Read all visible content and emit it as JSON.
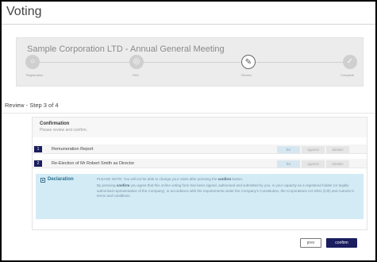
{
  "page": {
    "title": "Voting"
  },
  "meeting": {
    "title": "Sample Corporation LTD - Annual General Meeting"
  },
  "steps": [
    {
      "label": "Registration",
      "icon": "○",
      "state": "done"
    },
    {
      "label": "PAS",
      "icon": "◎",
      "state": "done"
    },
    {
      "label": "Review",
      "icon": "✎",
      "state": "current"
    },
    {
      "label": "Complete",
      "icon": "✓",
      "state": "pending"
    }
  ],
  "review_heading": "Review - Step 3 of 4",
  "confirmation": {
    "title": "Confirmation",
    "subtitle": "Please review and confirm."
  },
  "resolutions": [
    {
      "number": "1",
      "text": "Remuneration Report",
      "options": [
        "for",
        "against",
        "abstain"
      ],
      "selected": "for"
    },
    {
      "number": "2",
      "text": "Re-Election of Mr Robert Smith as Director",
      "options": [
        "for",
        "against",
        "abstain"
      ],
      "selected": "for"
    }
  ],
  "declaration": {
    "label": "Declaration",
    "note_prefix": "PLEASE NOTE: You will not be able to change your votes after pressing the ",
    "note_bold": "confirm",
    "note_suffix": " button.",
    "body_prefix": "By pressing ",
    "body_bold": "confirm",
    "body_suffix": " you agree that this online voting form has been signed, authorised and submitted by you, in your capacity as a registered holder (or legally authorised representative of the Company), in accordance with the requirements under the Company's Constitution, the Corporations Act 2001 (Cth) and Automic's terms and conditions."
  },
  "buttons": {
    "prev": "prev",
    "confirm": "confirm"
  },
  "colors": {
    "primary": "#1a1d5e",
    "declaration_bg": "#d3ebf5",
    "vote_selected": "#d7e7f1"
  }
}
